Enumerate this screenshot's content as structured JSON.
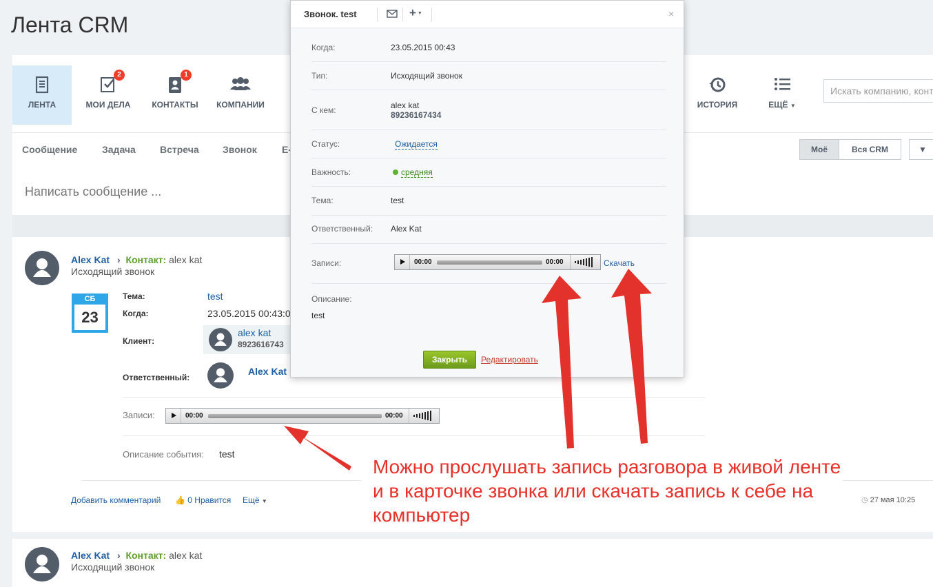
{
  "page": {
    "title": "Лента CRM"
  },
  "nav": {
    "items": [
      {
        "label": "ЛЕНТА",
        "icon": "feed-icon"
      },
      {
        "label": "МОИ ДЕЛА",
        "icon": "tasks-icon",
        "badge": "2"
      },
      {
        "label": "КОНТАКТЫ",
        "icon": "contacts-icon",
        "badge": "1"
      },
      {
        "label": "КОМПАНИИ",
        "icon": "companies-icon"
      },
      {
        "label": "ИСТОРИЯ",
        "icon": "history-icon"
      },
      {
        "label": "ЕЩЁ",
        "icon": "more-list-icon"
      }
    ],
    "search_placeholder": "Искать компанию, конт"
  },
  "tabs": {
    "items": [
      "Сообщение",
      "Задача",
      "Встреча",
      "Звонок",
      "E-"
    ],
    "filter_mine": "Моё",
    "filter_all": "Вся CRM"
  },
  "compose": {
    "placeholder": "Написать сообщение ..."
  },
  "feed": {
    "post1": {
      "author": "Alex Kat",
      "contact_label": "Контакт:",
      "contact_name": "alex kat",
      "subtitle": "Исходящий звонок",
      "calendar_dow": "СБ",
      "calendar_day": "23",
      "subject_label": "Тема:",
      "subject_value": "test",
      "when_label": "Когда:",
      "when_value": "23.05.2015 00:43:0",
      "client_label": "Клиент:",
      "client_name": "alex kat",
      "client_phone": "8923616743",
      "responsible_label": "Ответственный:",
      "responsible_name": "Alex Kat",
      "records_label": "Записи:",
      "player_time_start": "00:00",
      "player_time_end": "00:00",
      "description_label": "Описание события:",
      "description_value": "test",
      "add_comment": "Добавить комментарий",
      "likes": "0 Нравится",
      "more": "Ещё",
      "timestamp": "27 мая 10:25"
    },
    "post2": {
      "author": "Alex Kat",
      "contact_label": "Контакт:",
      "contact_name": "alex kat",
      "subtitle": "Исходящий звонок"
    }
  },
  "popup": {
    "title": "Звонок. test",
    "rows": {
      "when_label": "Когда:",
      "when_value": "23.05.2015 00:43",
      "type_label": "Тип:",
      "type_value": "Исходящий звонок",
      "with_label": "С кем:",
      "with_name": "alex kat",
      "with_phone": "89236167434",
      "status_label": "Статус:",
      "status_value": "Ожидается",
      "priority_label": "Важность:",
      "priority_value": "средняя",
      "subject_label": "Тема:",
      "subject_value": "test",
      "responsible_label": "Ответственный:",
      "responsible_value": "Alex Kat",
      "records_label": "Записи:",
      "player_time_start": "00:00",
      "player_time_end": "00:00",
      "download": "Скачать",
      "description_label": "Описание:",
      "description_value": "test"
    },
    "close_button": "Закрыть",
    "edit_link": "Редактировать"
  },
  "annotation": {
    "text": "Можно прослушать запись разговора в живой ленте и в карточке звонка или скачать запись к себе на компьютер",
    "color": "#e8302a"
  },
  "colors": {
    "accent_link": "#1f5fa6",
    "contact_green": "#5f9e2a",
    "badge_red": "#f03c28",
    "active_tab": "#d7ecf8",
    "calendar_blue": "#2fa6e8"
  }
}
